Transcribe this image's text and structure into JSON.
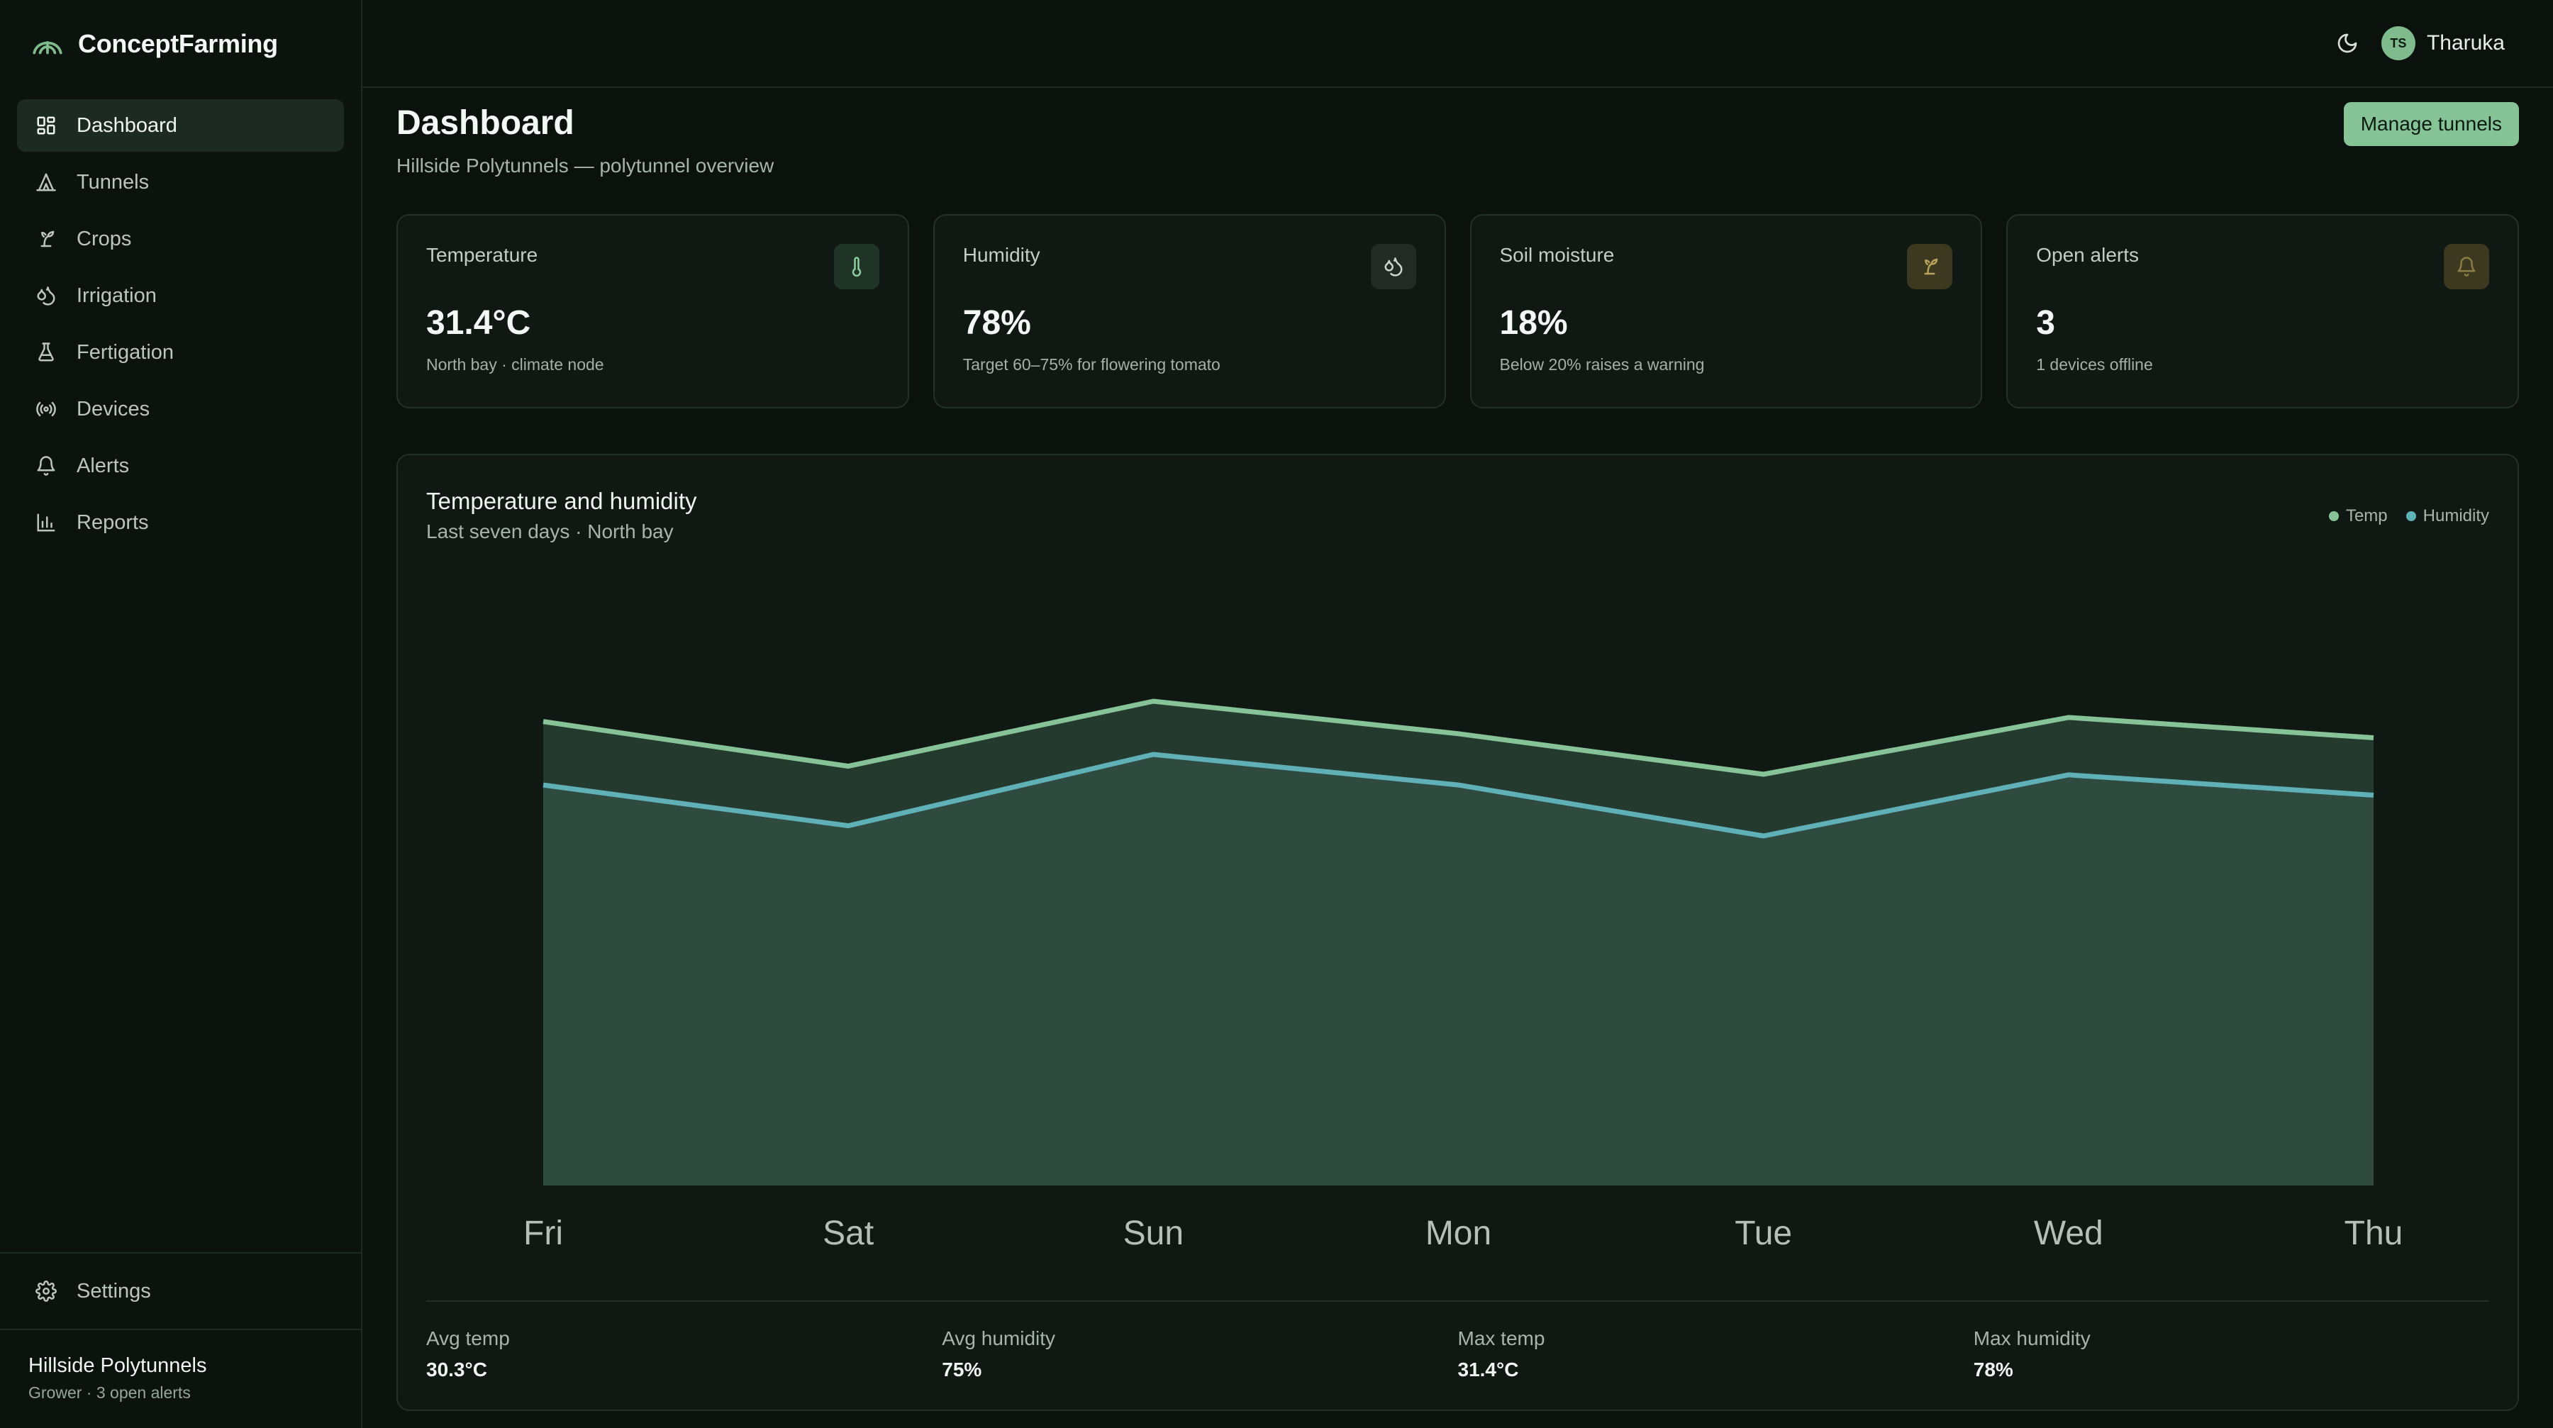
{
  "app": {
    "name": "ConceptFarming"
  },
  "sidebar": {
    "items": [
      {
        "label": "Dashboard",
        "icon": "dashboard-icon",
        "active": true
      },
      {
        "label": "Tunnels",
        "icon": "tunnel-icon"
      },
      {
        "label": "Crops",
        "icon": "sprout-icon"
      },
      {
        "label": "Irrigation",
        "icon": "droplets-icon"
      },
      {
        "label": "Fertigation",
        "icon": "flask-icon"
      },
      {
        "label": "Devices",
        "icon": "radio-icon"
      },
      {
        "label": "Alerts",
        "icon": "bell-icon"
      },
      {
        "label": "Reports",
        "icon": "bar-chart-icon"
      }
    ],
    "settings_label": "Settings",
    "farm": {
      "name": "Hillside Polytunnels",
      "meta": "Grower · 3 open alerts"
    }
  },
  "topbar": {
    "user": {
      "initials": "TS",
      "name": "Tharuka"
    }
  },
  "page": {
    "title": "Dashboard",
    "subtitle": "Hillside Polytunnels — polytunnel overview",
    "manage_button": "Manage tunnels"
  },
  "stats": [
    {
      "label": "Temperature",
      "value": "31.4°C",
      "note": "North bay · climate node",
      "icon": "thermometer-icon"
    },
    {
      "label": "Humidity",
      "value": "78%",
      "note": "Target 60–75% for flowering tomato",
      "icon": "droplets-icon"
    },
    {
      "label": "Soil moisture",
      "value": "18%",
      "note": "Below 20% raises a warning",
      "icon": "sprout-icon"
    },
    {
      "label": "Open alerts",
      "value": "3",
      "note": "1 devices offline",
      "icon": "bell-icon"
    }
  ],
  "chart": {
    "title": "Temperature and humidity",
    "subtitle": "Last seven days · North bay",
    "legend": [
      {
        "name": "Temp",
        "color": "#86c397"
      },
      {
        "name": "Humidity",
        "color": "#5fb0b7"
      }
    ]
  },
  "chart_data": {
    "type": "area",
    "categories": [
      "Fri",
      "Sat",
      "Sun",
      "Mon",
      "Tue",
      "Wed",
      "Thu"
    ],
    "series": [
      {
        "name": "Temp",
        "color": "#86c397",
        "values": [
          30.9,
          29.8,
          31.4,
          30.6,
          29.6,
          31.0,
          30.5
        ]
      },
      {
        "name": "Humidity",
        "color": "#5fb0b7",
        "values": [
          75,
          71,
          78,
          75,
          70,
          76,
          74
        ]
      }
    ],
    "grid": false
  },
  "summary": [
    {
      "label": "Avg temp",
      "value": "30.3°C"
    },
    {
      "label": "Avg humidity",
      "value": "75%"
    },
    {
      "label": "Max temp",
      "value": "31.4°C"
    },
    {
      "label": "Max humidity",
      "value": "78%"
    }
  ]
}
